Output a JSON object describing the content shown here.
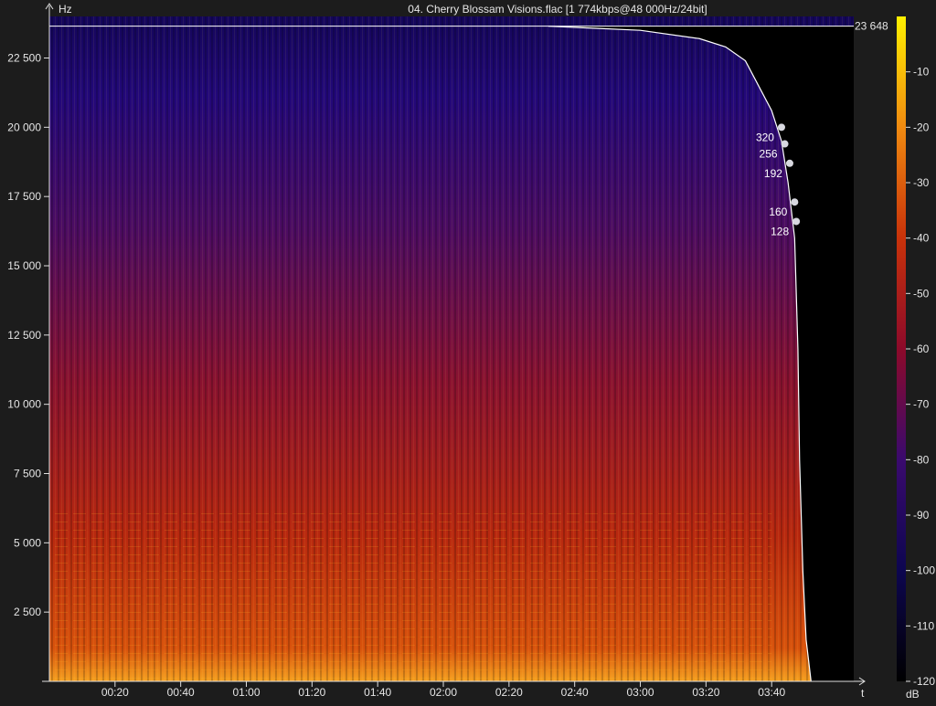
{
  "window": {
    "title": "04. Cherry Blossam Visions.flac [1 774kbps@48 000Hz/24bit]"
  },
  "chart_data": {
    "type": "heatmap",
    "title": "04. Cherry Blossam Visions.flac [1 774kbps@48 000Hz/24bit]",
    "xlabel": "t",
    "ylabel": "Hz",
    "colorbar_label": "dB",
    "xlim": [
      0,
      245
    ],
    "ylim": [
      0,
      24000
    ],
    "x_ticks": [
      {
        "t": 20,
        "label": "00:20"
      },
      {
        "t": 40,
        "label": "00:40"
      },
      {
        "t": 60,
        "label": "01:00"
      },
      {
        "t": 80,
        "label": "01:20"
      },
      {
        "t": 100,
        "label": "01:40"
      },
      {
        "t": 120,
        "label": "02:00"
      },
      {
        "t": 140,
        "label": "02:20"
      },
      {
        "t": 160,
        "label": "02:40"
      },
      {
        "t": 180,
        "label": "03:00"
      },
      {
        "t": 200,
        "label": "03:20"
      },
      {
        "t": 220,
        "label": "03:40"
      }
    ],
    "y_ticks": [
      {
        "hz": 2500,
        "label": "2 500"
      },
      {
        "hz": 5000,
        "label": "5 000"
      },
      {
        "hz": 7500,
        "label": "7 500"
      },
      {
        "hz": 10000,
        "label": "10 000"
      },
      {
        "hz": 12500,
        "label": "12 500"
      },
      {
        "hz": 15000,
        "label": "15 000"
      },
      {
        "hz": 17500,
        "label": "17 500"
      },
      {
        "hz": 20000,
        "label": "20 000"
      },
      {
        "hz": 22500,
        "label": "22 500"
      }
    ],
    "colorbar_ticks": [
      {
        "db": -10,
        "label": "-10"
      },
      {
        "db": -20,
        "label": "-20"
      },
      {
        "db": -30,
        "label": "-30"
      },
      {
        "db": -40,
        "label": "-40"
      },
      {
        "db": -50,
        "label": "-50"
      },
      {
        "db": -60,
        "label": "-60"
      },
      {
        "db": -70,
        "label": "-70"
      },
      {
        "db": -80,
        "label": "-80"
      },
      {
        "db": -90,
        "label": "-90"
      },
      {
        "db": -100,
        "label": "-100"
      },
      {
        "db": -110,
        "label": "-110"
      },
      {
        "db": -120,
        "label": "-120"
      }
    ],
    "db_range": [
      -120,
      0
    ],
    "max_frequency_line": {
      "hz": 23648,
      "label": "23 648"
    },
    "cutoff_curve": [
      {
        "t": 152,
        "hz": 23648
      },
      {
        "t": 180,
        "hz": 23500
      },
      {
        "t": 198,
        "hz": 23200
      },
      {
        "t": 206,
        "hz": 22900
      },
      {
        "t": 212,
        "hz": 22400
      },
      {
        "t": 216,
        "hz": 21500
      },
      {
        "t": 220,
        "hz": 20600
      },
      {
        "t": 223,
        "hz": 19500
      },
      {
        "t": 225,
        "hz": 18000
      },
      {
        "t": 227,
        "hz": 16000
      },
      {
        "t": 228,
        "hz": 12000
      },
      {
        "t": 228.5,
        "hz": 8000
      },
      {
        "t": 229.5,
        "hz": 4000
      },
      {
        "t": 230.5,
        "hz": 1500
      },
      {
        "t": 232,
        "hz": 0
      }
    ],
    "bitrate_markers": [
      {
        "label": "320",
        "t": 223,
        "hz": 20000
      },
      {
        "label": "256",
        "t": 224,
        "hz": 19400
      },
      {
        "label": "192",
        "t": 225.5,
        "hz": 18700
      },
      {
        "label": "160",
        "t": 227,
        "hz": 17300
      },
      {
        "label": "128",
        "t": 227.5,
        "hz": 16600
      }
    ],
    "colors": {
      "background": "#1c1c1c",
      "colormap": [
        "#000000",
        "#0d0650",
        "#3a0a6e",
        "#8c0a2a",
        "#c8320a",
        "#f08a10",
        "#fff000"
      ]
    }
  }
}
